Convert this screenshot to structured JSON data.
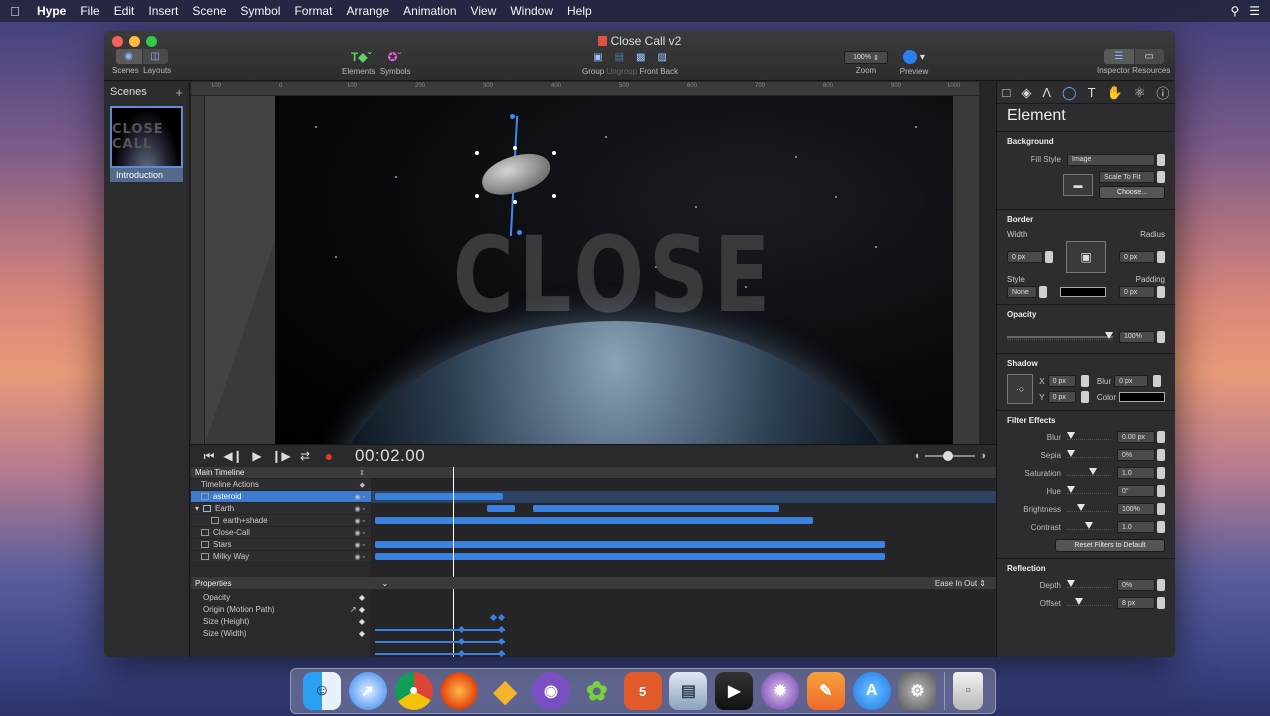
{
  "menubar": {
    "app_name": "Hype",
    "items": [
      "File",
      "Edit",
      "Insert",
      "Scene",
      "Symbol",
      "Format",
      "Arrange",
      "Animation",
      "View",
      "Window",
      "Help"
    ],
    "right_icons": [
      "search-icon",
      "list-icon"
    ]
  },
  "window": {
    "title": "Close Call v2"
  },
  "toolbar": {
    "scenes_label": "Scenes",
    "layouts_label": "Layouts",
    "elements_label": "Elements",
    "symbols_label": "Symbols",
    "group_label": "Group",
    "ungroup_label": "Ungroup",
    "front_label": "Front",
    "back_label": "Back",
    "zoom_value": "100%",
    "zoom_label": "Zoom",
    "preview_label": "Preview",
    "inspector_label": "Inspector",
    "resources_label": "Resources"
  },
  "scenes_panel": {
    "title": "Scenes",
    "add": "+",
    "thumb_text": "CLOSE CALL",
    "scene_name": "Introduction"
  },
  "ruler": {
    "marks": [
      "100",
      "0",
      "100",
      "200",
      "300",
      "400",
      "500",
      "600",
      "700",
      "800",
      "900",
      "1000"
    ]
  },
  "stage": {
    "title_text": "CLOSE CALL"
  },
  "timeline": {
    "time": "00:02.00",
    "rows": [
      {
        "label": "Main Timeline",
        "kind": "head"
      },
      {
        "label": "Timeline Actions",
        "kind": "action"
      },
      {
        "label": "asteroid",
        "kind": "selected"
      },
      {
        "label": "Earth",
        "kind": "group"
      },
      {
        "label": "earth+shade",
        "kind": "child"
      },
      {
        "label": "Close-Call",
        "kind": "item"
      },
      {
        "label": "Stars",
        "kind": "item"
      },
      {
        "label": "Milky Way",
        "kind": "item"
      }
    ],
    "properties_title": "Properties",
    "easing": "Ease In Out",
    "properties": [
      "Opacity",
      "Origin (Motion Path)",
      "Size (Height)",
      "Size (Width)"
    ]
  },
  "inspector": {
    "title": "Element",
    "background": {
      "title": "Background",
      "fill_style_label": "Fill Style",
      "fill_style_value": "Image",
      "scale_value": "Scale To Fit",
      "choose_label": "Choose..."
    },
    "border": {
      "title": "Border",
      "width_label": "Width",
      "width_value": "0 px",
      "radius_label": "Radius",
      "radius_value": "0 px",
      "style_label": "Style",
      "style_value": "None",
      "padding_label": "Padding",
      "padding_value": "0 px"
    },
    "opacity": {
      "title": "Opacity",
      "value": "100%"
    },
    "shadow": {
      "title": "Shadow",
      "x_label": "X",
      "x_value": "0 px",
      "y_label": "Y",
      "y_value": "0 px",
      "blur_label": "Blur",
      "blur_value": "0 px",
      "color_label": "Color"
    },
    "filters": {
      "title": "Filter Effects",
      "items": [
        {
          "label": "Blur",
          "value": "0.00 px"
        },
        {
          "label": "Sepia",
          "value": "0%"
        },
        {
          "label": "Saturation",
          "value": "1.0"
        },
        {
          "label": "Hue",
          "value": "0°"
        },
        {
          "label": "Brightness",
          "value": "100%"
        },
        {
          "label": "Contrast",
          "value": "1.0"
        }
      ],
      "reset_label": "Reset Filters to Default"
    },
    "reflection": {
      "title": "Reflection",
      "depth_label": "Depth",
      "depth_value": "0%",
      "offset_label": "Offset",
      "offset_value": "8 px"
    }
  },
  "dock": {
    "apps": [
      "finder-icon",
      "safari-icon",
      "chrome-icon",
      "firefox-icon",
      "sketch-icon",
      "github-icon",
      "leaf-icon",
      "html5-icon",
      "preview-icon",
      "final-cut-icon",
      "motion-icon",
      "pages-icon",
      "app-store-icon",
      "system-preferences-icon",
      "trash-icon"
    ]
  }
}
